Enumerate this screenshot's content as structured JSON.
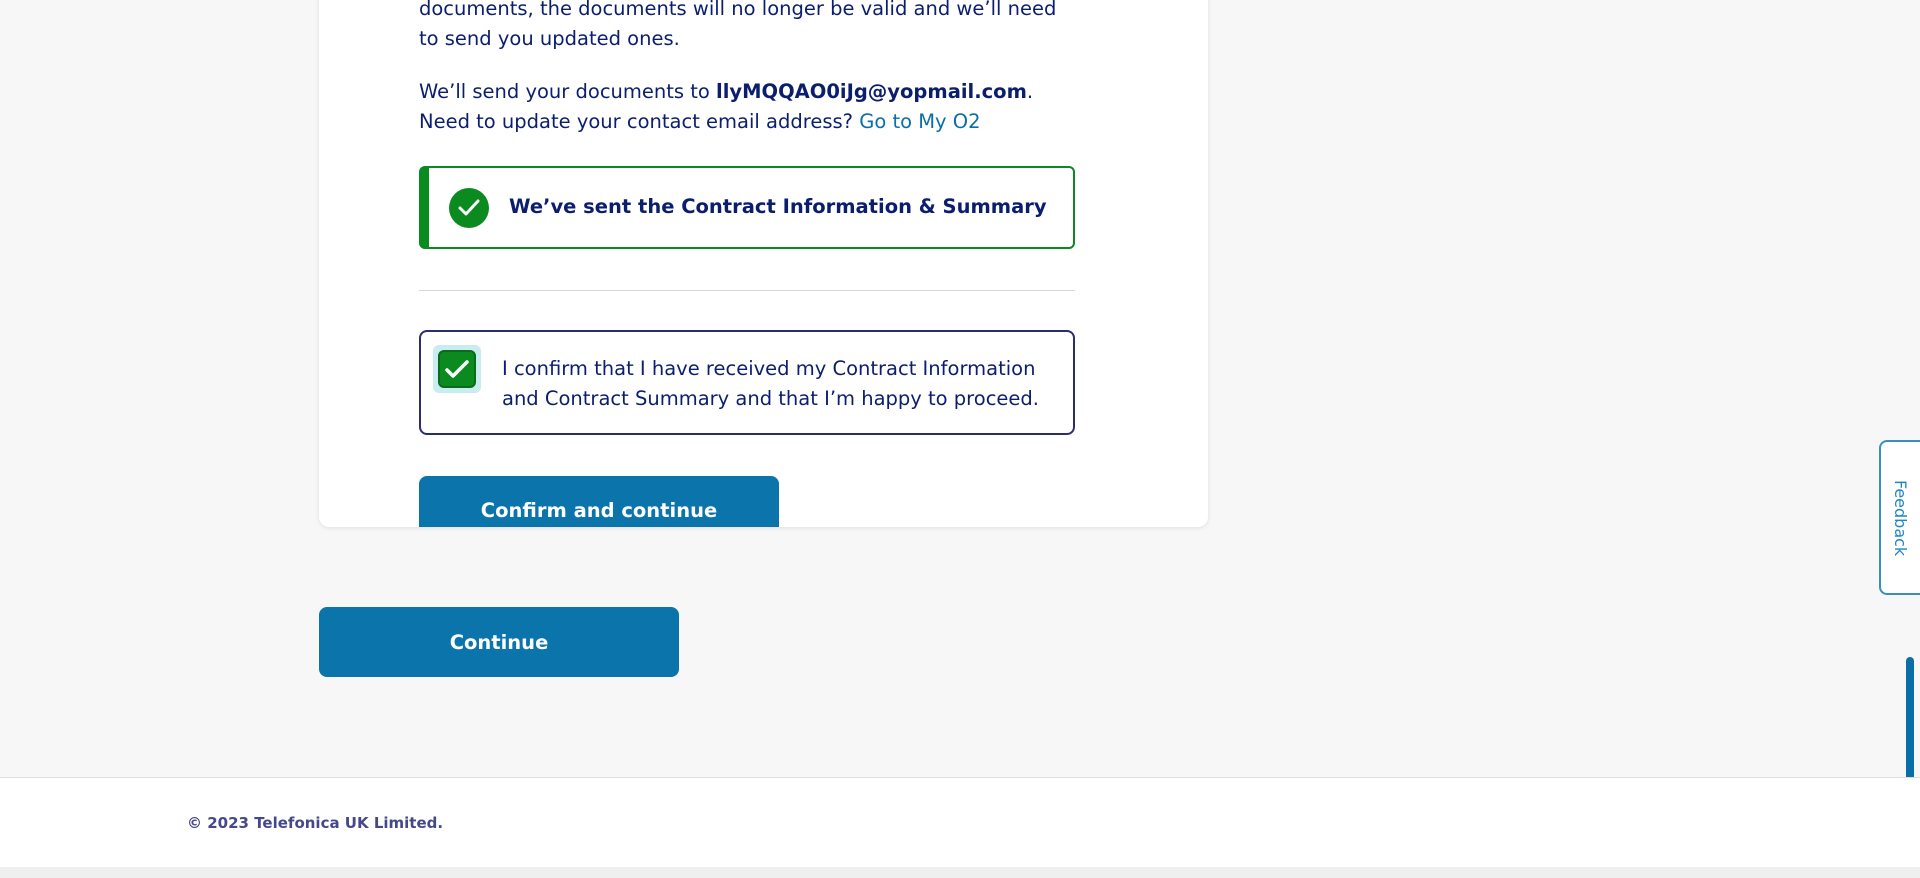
{
  "content": {
    "documents_text": "documents, the documents will no longer be valid and we’ll need to send you updated ones.",
    "send_prefix": "We’ll send your documents to ",
    "email": "llyMQQAO0iJg@yopmail.com",
    "send_suffix": ". Need to update your contact email address? ",
    "my_o2_link": "Go to My O2"
  },
  "success_message": {
    "text": "We’ve sent the Contract Information & Summary",
    "color": "#0a8a1f"
  },
  "confirm_checkbox": {
    "checked": true,
    "label": "I confirm that I have received my Contract Information and Contract Summary and that I’m happy to proceed."
  },
  "buttons": {
    "confirm_and_continue": "Confirm and continue",
    "continue": "Continue"
  },
  "feedback": {
    "label": "Feedback"
  },
  "footer": {
    "copyright": "© 2023 Telefonica UK Limited."
  },
  "colors": {
    "primary_button": "#0a74ab",
    "text": "#0b1e6e",
    "link": "#0a6fa8"
  }
}
